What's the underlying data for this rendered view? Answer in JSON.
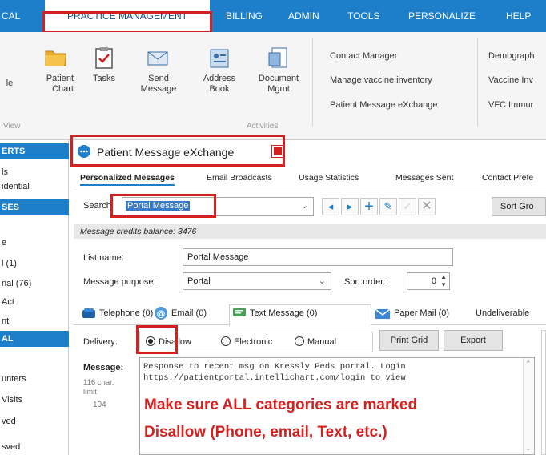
{
  "menubar": {
    "items": [
      {
        "label": "CAL"
      },
      {
        "label": "PRACTICE MANAGEMENT"
      },
      {
        "label": "BILLING"
      },
      {
        "label": "ADMIN"
      },
      {
        "label": "TOOLS"
      },
      {
        "label": "PERSONALIZE"
      },
      {
        "label": "HELP"
      }
    ]
  },
  "ribbon": {
    "buttons": [
      {
        "label": "le",
        "icon": "partial-icon"
      },
      {
        "label": "Patient\nChart",
        "icon": "folder-icon"
      },
      {
        "label": "Tasks",
        "icon": "clipboard-check-icon"
      },
      {
        "label": "Send\nMessage",
        "icon": "envelope-icon"
      },
      {
        "label": "Address\nBook",
        "icon": "address-book-icon"
      },
      {
        "label": "Document\nMgmt",
        "icon": "document-icon"
      }
    ],
    "groups": {
      "view": "View",
      "activities": "Activities"
    },
    "links_col1": [
      "Contact Manager",
      "Manage vaccine inventory",
      "Patient Message eXchange"
    ],
    "links_col2": [
      "Demograph",
      "Vaccine Inv",
      "VFC Immur"
    ]
  },
  "sidebar": {
    "items": [
      {
        "label": "ERTS",
        "style": "blue"
      },
      {
        "label": "ls",
        "style": "plain"
      },
      {
        "label": "idential",
        "style": "plain"
      },
      {
        "label": "SES",
        "style": "blue"
      },
      {
        "label": "e",
        "style": "plain"
      },
      {
        "label": "l (1)",
        "style": "plain"
      },
      {
        "label": "nal (76)",
        "style": "plain"
      },
      {
        "label": "Act",
        "style": "plain"
      },
      {
        "label": "nt",
        "style": "plain"
      },
      {
        "label": "AL",
        "style": "blue"
      },
      {
        "label": "unters",
        "style": "plain"
      },
      {
        "label": "Visits",
        "style": "plain"
      },
      {
        "label": "ved",
        "style": "plain"
      },
      {
        "label": "sved",
        "style": "plain"
      }
    ]
  },
  "window": {
    "title": "Patient Message eXchange",
    "tabs": [
      "Personalized Messages",
      "Email Broadcasts",
      "Usage Statistics",
      "Messages Sent",
      "Contact Prefe"
    ],
    "search_label": "Search:",
    "search_value": "Portal Message",
    "sort_button": "Sort Gro",
    "credits_text": "Message credits balance: 3476",
    "list_name_label": "List name:",
    "list_name_value": "Portal Message",
    "purpose_label": "Message purpose:",
    "purpose_value": "Portal",
    "sort_order_label": "Sort order:",
    "sort_order_value": "0",
    "channel_tabs": [
      {
        "label": "Telephone (0)",
        "icon": "phone-icon"
      },
      {
        "label": "Email (0)",
        "icon": "email-icon"
      },
      {
        "label": "Text Message (0)",
        "icon": "text-message-icon"
      },
      {
        "label": "Paper Mail (0)",
        "icon": "paper-mail-icon"
      },
      {
        "label": "Undeliverable",
        "icon": ""
      }
    ],
    "delivery_label": "Delivery:",
    "delivery_options": [
      "Disallow",
      "Electronic",
      "Manual"
    ],
    "print_grid": "Print Grid",
    "export": "Export",
    "message_label": "Message:",
    "char_limit": "116 char.\nlimit",
    "char_count": "104",
    "message_text": "Response to recent msg on Kressly Peds portal. Login\nhttps://patientportal.intellichart.com/login to view"
  },
  "annotation": {
    "line1": "Make sure ALL categories are marked",
    "line2": "Disallow (Phone, email, Text, etc.)",
    "color": "#d62020"
  }
}
